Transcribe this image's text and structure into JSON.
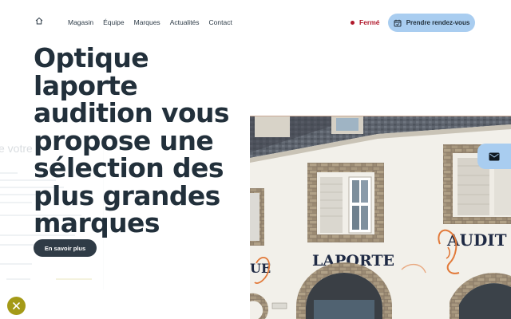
{
  "header": {
    "nav": [
      "Magasin",
      "Équipe",
      "Marques",
      "Actualités",
      "Contact"
    ],
    "status": "Fermé",
    "rdv_label": "Prendre rendez-vous"
  },
  "hero": {
    "title_lines": [
      "Optique laporte",
      "audition vous",
      "propose une",
      "sélection des",
      "plus grandes",
      "marques"
    ],
    "cta_label": "En savoir plus"
  },
  "popup": {
    "title_fragment": "e votre"
  },
  "photo": {
    "sign_laporte": "LAPORTE",
    "sign_audition": "AUDIT",
    "sign_left": "UE"
  },
  "colors": {
    "primary_text": "#22303b",
    "accent_blue": "#a9cdf0",
    "status_red": "#b0182b",
    "close_olive": "#a49a17",
    "cta_dark": "#2f3b46"
  },
  "icons": {
    "home": "home-icon",
    "calendar": "calendar-icon",
    "mail": "mail-icon",
    "close": "close-icon"
  }
}
